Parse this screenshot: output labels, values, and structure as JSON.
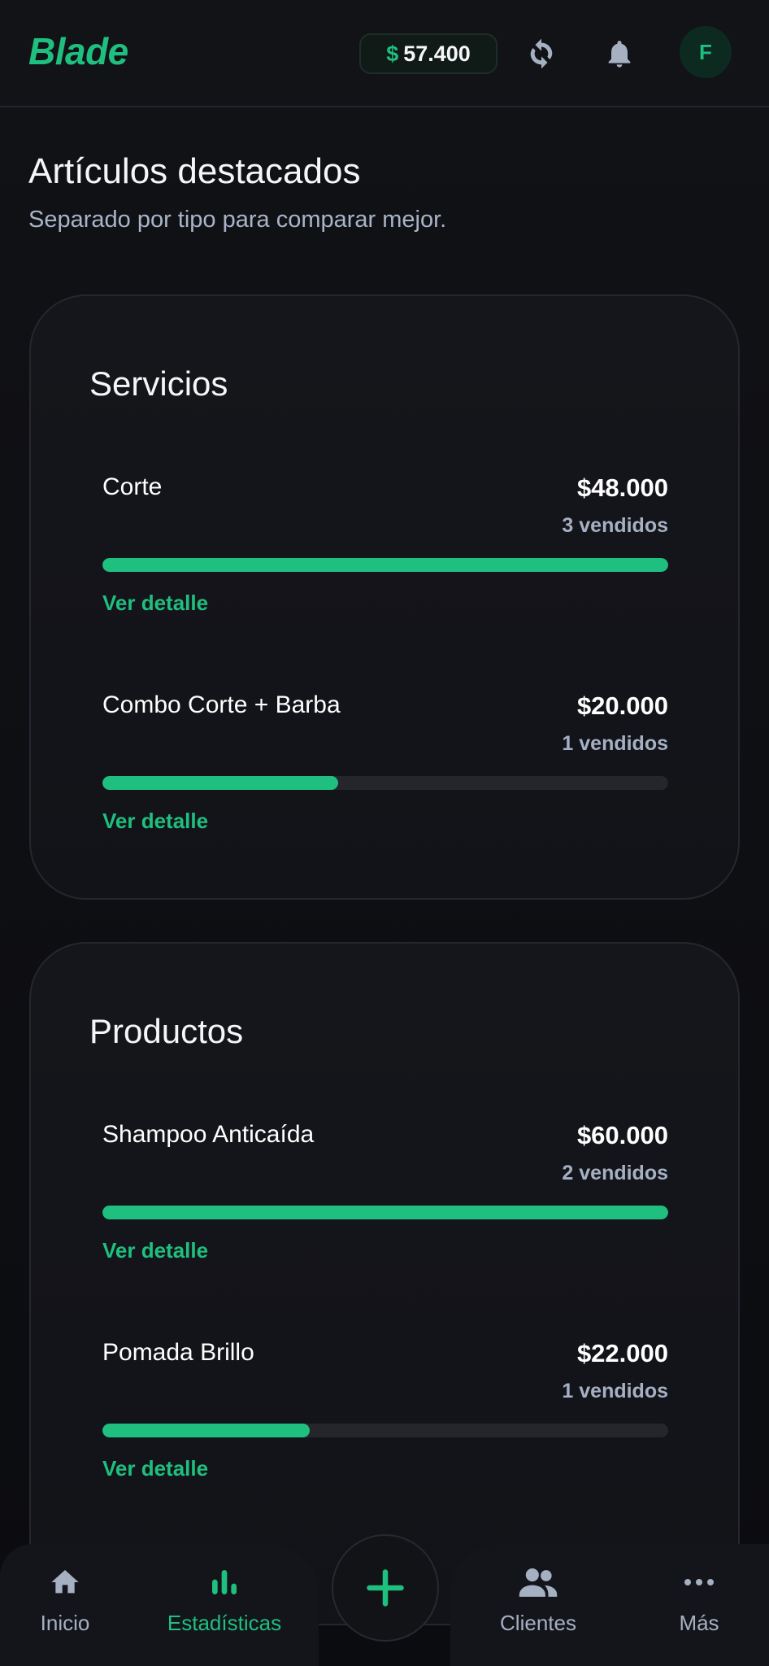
{
  "header": {
    "brand": "Blade",
    "balance_currency": "$",
    "balance_value": "57.400",
    "avatar_initial": "F"
  },
  "section": {
    "title": "Artículos destacados",
    "subtitle": "Separado por tipo para comparar mejor."
  },
  "cards": [
    {
      "title": "Servicios",
      "items": [
        {
          "name": "Corte",
          "price": "$48.000",
          "count": "3 vendidos",
          "progress": 1.0,
          "detail": "Ver detalle"
        },
        {
          "name": "Combo Corte + Barba",
          "price": "$20.000",
          "count": "1 vendidos",
          "progress": 0.417,
          "detail": "Ver detalle"
        }
      ]
    },
    {
      "title": "Productos",
      "items": [
        {
          "name": "Shampoo Anticaída",
          "price": "$60.000",
          "count": "2 vendidos",
          "progress": 1.0,
          "detail": "Ver detalle"
        },
        {
          "name": "Pomada Brillo",
          "price": "$22.000",
          "count": "1 vendidos",
          "progress": 0.367,
          "detail": "Ver detalle"
        }
      ]
    }
  ],
  "nav": {
    "items": [
      {
        "label": "Inicio",
        "icon": "home-icon"
      },
      {
        "label": "Estadísticas",
        "icon": "bar-chart-icon",
        "active": true
      },
      {
        "label": "Clientes",
        "icon": "users-icon"
      },
      {
        "label": "Más",
        "icon": "more-dots-icon"
      }
    ],
    "fab_icon": "plus-icon"
  },
  "colors": {
    "accent": "#1fbf7f",
    "background": "#0c0d10",
    "card": "#14151a",
    "muted_text": "#a6b0c3"
  }
}
